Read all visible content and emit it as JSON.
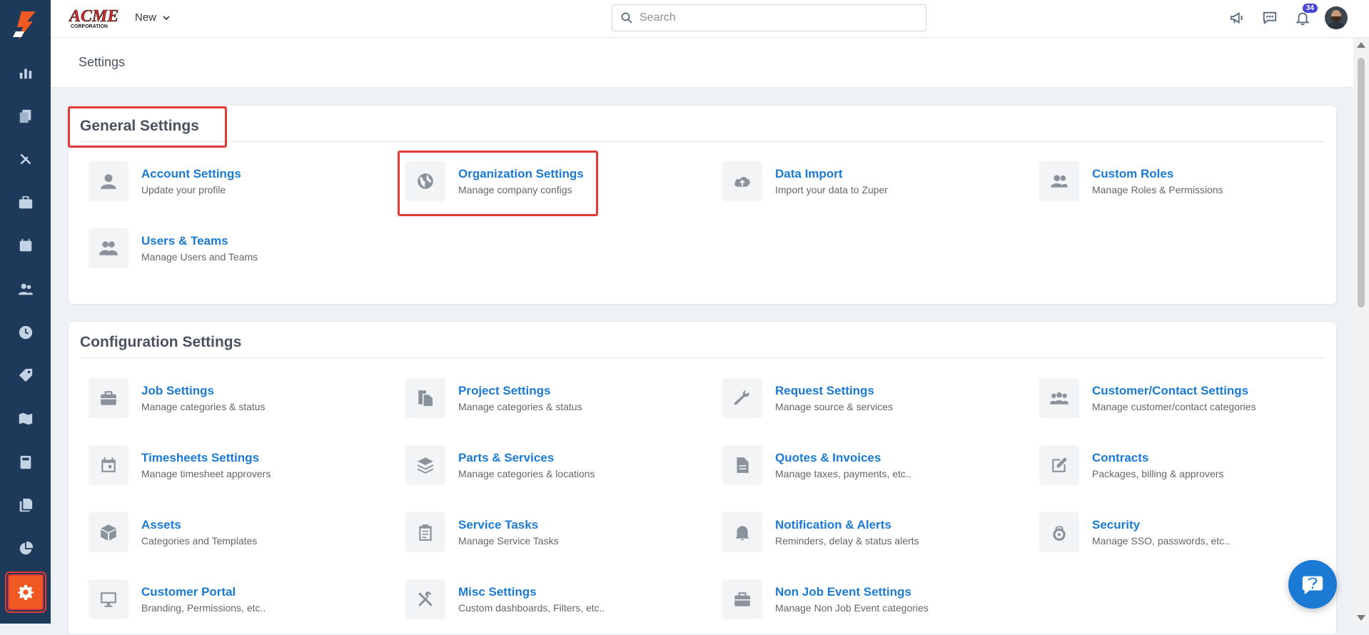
{
  "app": {
    "logo_text": "ACME",
    "logo_subtext": "CORPORATION",
    "new_label": "New"
  },
  "search": {
    "placeholder": "Search"
  },
  "notifications": {
    "count": "34"
  },
  "page": {
    "title": "Settings"
  },
  "general": {
    "title": "General Settings",
    "items": [
      {
        "title": "Account Settings",
        "desc": "Update your profile",
        "icon": "user-icon"
      },
      {
        "title": "Organization Settings",
        "desc": "Manage company configs",
        "icon": "globe-icon"
      },
      {
        "title": "Data Import",
        "desc": "Import your data to Zuper",
        "icon": "cloud-upload-icon"
      },
      {
        "title": "Custom Roles",
        "desc": "Manage Roles & Permissions",
        "icon": "users-icon"
      },
      {
        "title": "Users & Teams",
        "desc": "Manage Users and Teams",
        "icon": "team-icon"
      }
    ]
  },
  "config": {
    "title": "Configuration Settings",
    "items": [
      {
        "title": "Job Settings",
        "desc": "Manage categories & status",
        "icon": "briefcase-icon"
      },
      {
        "title": "Project Settings",
        "desc": "Manage categories & status",
        "icon": "documents-icon"
      },
      {
        "title": "Request Settings",
        "desc": "Manage source & services",
        "icon": "wrench-icon"
      },
      {
        "title": "Customer/Contact Settings",
        "desc": "Manage customer/contact categories",
        "icon": "group-icon"
      },
      {
        "title": "Timesheets Settings",
        "desc": "Manage timesheet approvers",
        "icon": "calendar-icon"
      },
      {
        "title": "Parts & Services",
        "desc": "Manage categories & locations",
        "icon": "layers-icon"
      },
      {
        "title": "Quotes & Invoices",
        "desc": "Manage taxes, payments, etc..",
        "icon": "document-icon"
      },
      {
        "title": "Contracts",
        "desc": "Packages, billing & approvers",
        "icon": "edit-icon"
      },
      {
        "title": "Assets",
        "desc": "Categories and Templates",
        "icon": "cube-icon"
      },
      {
        "title": "Service Tasks",
        "desc": "Manage Service Tasks",
        "icon": "clipboard-icon"
      },
      {
        "title": "Notification & Alerts",
        "desc": "Reminders, delay & status alerts",
        "icon": "bell-icon"
      },
      {
        "title": "Security",
        "desc": "Manage SSO, passwords, etc..",
        "icon": "lock-icon"
      },
      {
        "title": "Customer Portal",
        "desc": "Branding, Permissions, etc..",
        "icon": "monitor-icon"
      },
      {
        "title": "Misc Settings",
        "desc": "Custom dashboards, Filters, etc..",
        "icon": "tools-icon"
      },
      {
        "title": "Non Job Event Settings",
        "desc": "Manage Non Job Event categories",
        "icon": "briefcase-icon"
      }
    ]
  },
  "colors": {
    "sidebar": "#1e3a5a",
    "accent": "#1a7ad4",
    "active": "#f05a22",
    "highlight": "#e53935"
  }
}
